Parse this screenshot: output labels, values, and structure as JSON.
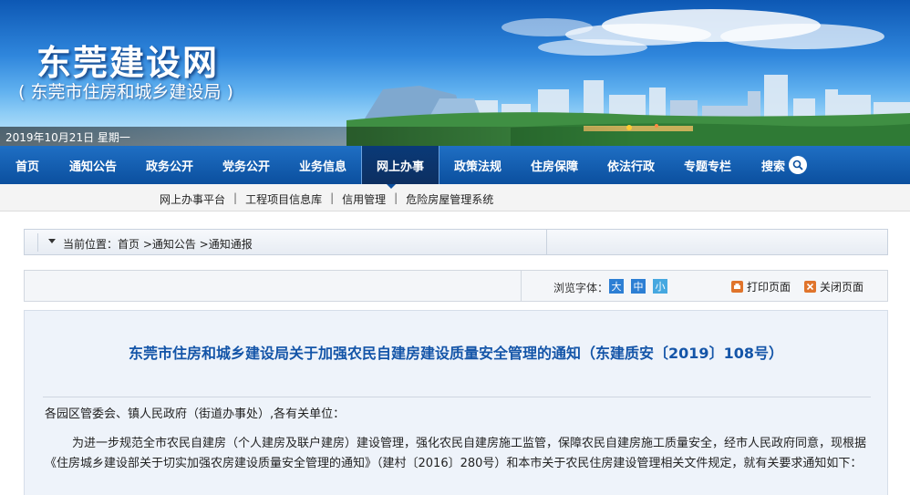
{
  "header": {
    "site_title": "东莞建设网",
    "site_subtitle": "( 东莞市住房和城乡建设局 )",
    "date_text": "2019年10月21日  星期一"
  },
  "main_nav": {
    "items": [
      {
        "label": "首页"
      },
      {
        "label": "通知公告"
      },
      {
        "label": "政务公开"
      },
      {
        "label": "党务公开"
      },
      {
        "label": "业务信息"
      },
      {
        "label": "网上办事",
        "active": true
      },
      {
        "label": "政策法规"
      },
      {
        "label": "住房保障"
      },
      {
        "label": "依法行政"
      },
      {
        "label": "专题专栏"
      },
      {
        "label": "搜索"
      }
    ]
  },
  "sub_nav": {
    "items": [
      "网上办事平台",
      "工程项目信息库",
      "信用管理",
      "危险房屋管理系统"
    ],
    "separator": "|"
  },
  "breadcrumb": {
    "text": "当前位置：首页 >通知公告 >通知通报"
  },
  "tools": {
    "font_label": "浏览字体：",
    "font_large": "大",
    "font_medium": "中",
    "font_small": "小",
    "print_label": "打印页面",
    "close_label": "关闭页面"
  },
  "article": {
    "title": "东莞市住房和城乡建设局关于加强农民自建房建设质量安全管理的通知（东建质安〔2019〕108号）",
    "salutation": "各园区管委会、镇人民政府（街道办事处）,各有关单位：",
    "paragraph_1": "为进一步规范全市农民自建房（个人建房及联户建房）建设管理，强化农民自建房施工监管，保障农民自建房施工质量安全，经市人民政府同意，现根据《住房城乡建设部关于切实加强农房建设质量安全管理的通知》（建村〔2016〕280号）和本市关于农民住房建设管理相关文件规定，就有关要求通知如下："
  },
  "colors": {
    "nav_blue": "#0b4f9e",
    "title_blue": "#1455a8",
    "font_large_bg": "#2d7fd4",
    "font_medium_bg": "#2d7fd4",
    "font_small_bg": "#46a8e0",
    "print_icon": "#e0742c",
    "close_icon": "#e0742c"
  }
}
